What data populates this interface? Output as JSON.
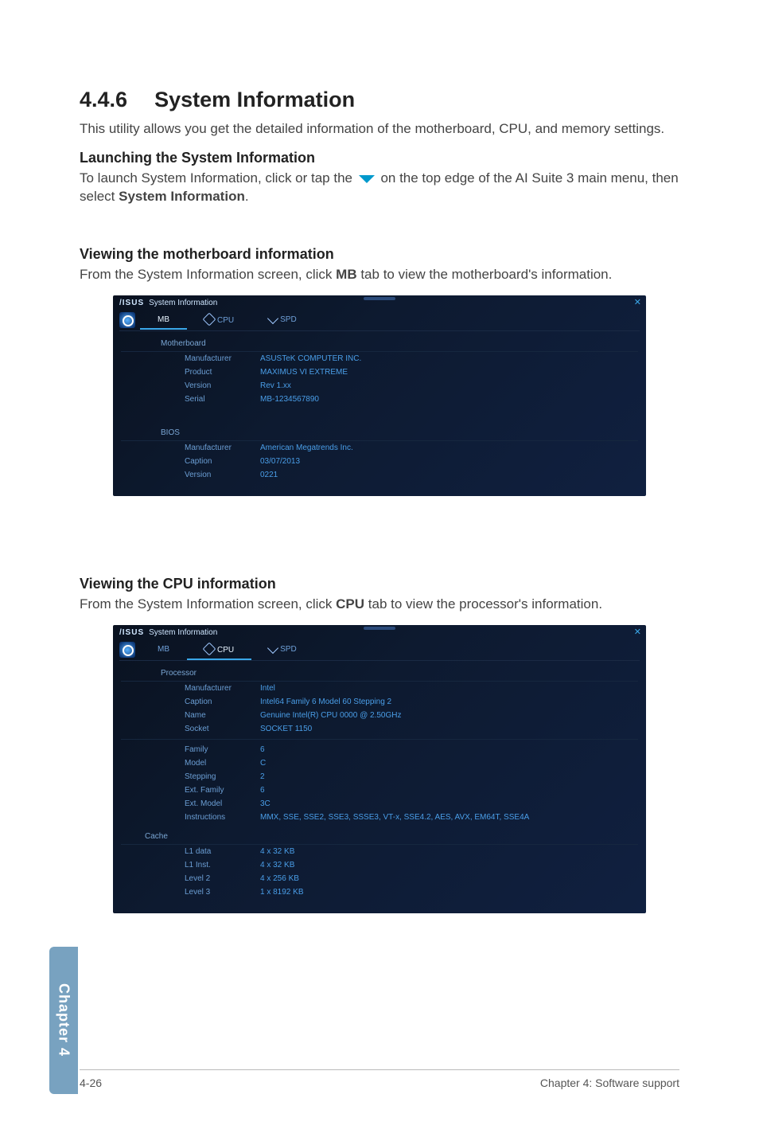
{
  "heading": {
    "number": "4.4.6",
    "title": "System Information"
  },
  "intro": "This utility allows you get the detailed information of the motherboard, CPU, and memory settings.",
  "launch": {
    "title": "Launching the System Information",
    "pre": "To launch System Information, click or tap the ",
    "post": " on the top edge of the AI Suite 3 main menu, then select ",
    "bold": "System Information",
    "period": "."
  },
  "mb": {
    "title": "Viewing the motherboard information",
    "pre": "From the System Information screen, click ",
    "bold": "MB",
    "post": " tab to view the motherboard's information."
  },
  "cpu": {
    "title": "Viewing the CPU information",
    "pre": "From the System Information screen, click ",
    "bold": "CPU",
    "post": " tab to view the processor's information."
  },
  "scr_common": {
    "brand": "/ISUS",
    "win_title": "System Information",
    "close": "✕",
    "tab_mb": "MB",
    "tab_cpu": "CPU",
    "tab_spd": "SPD"
  },
  "scr_mb": {
    "section1": "Motherboard",
    "rows1": [
      {
        "k": "Manufacturer",
        "v": "ASUSTeK COMPUTER INC."
      },
      {
        "k": "Product",
        "v": "MAXIMUS VI EXTREME"
      },
      {
        "k": "Version",
        "v": "Rev 1.xx"
      },
      {
        "k": "Serial",
        "v": "MB-1234567890"
      }
    ],
    "section2": "BIOS",
    "rows2": [
      {
        "k": "Manufacturer",
        "v": "American Megatrends Inc."
      },
      {
        "k": "Caption",
        "v": "03/07/2013"
      },
      {
        "k": "Version",
        "v": "0221"
      }
    ]
  },
  "scr_cpu": {
    "section1": "Processor",
    "rows1": [
      {
        "k": "Manufacturer",
        "v": "Intel"
      },
      {
        "k": "Caption",
        "v": "Intel64 Family 6 Model 60 Stepping 2"
      },
      {
        "k": "Name",
        "v": "Genuine Intel(R) CPU 0000 @ 2.50GHz"
      },
      {
        "k": "Socket",
        "v": "SOCKET 1150"
      }
    ],
    "rows2": [
      {
        "k": "Family",
        "v": "6"
      },
      {
        "k": "Model",
        "v": "C"
      },
      {
        "k": "Stepping",
        "v": "2"
      },
      {
        "k": "Ext. Family",
        "v": "6"
      },
      {
        "k": "Ext. Model",
        "v": "3C"
      },
      {
        "k": "Instructions",
        "v": "MMX, SSE, SSE2, SSE3, SSSE3, VT-x, SSE4.2, AES, AVX, EM64T, SSE4A"
      }
    ],
    "section3": "Cache",
    "rows3": [
      {
        "k": "L1 data",
        "v": "4 x 32 KB"
      },
      {
        "k": "L1 Inst.",
        "v": "4 x 32 KB"
      },
      {
        "k": "Level 2",
        "v": "4 x 256 KB"
      },
      {
        "k": "Level 3",
        "v": "1 x 8192 KB"
      }
    ]
  },
  "side_tab": "Chapter 4",
  "footer": {
    "left": "4-26",
    "right": "Chapter 4: Software support"
  }
}
